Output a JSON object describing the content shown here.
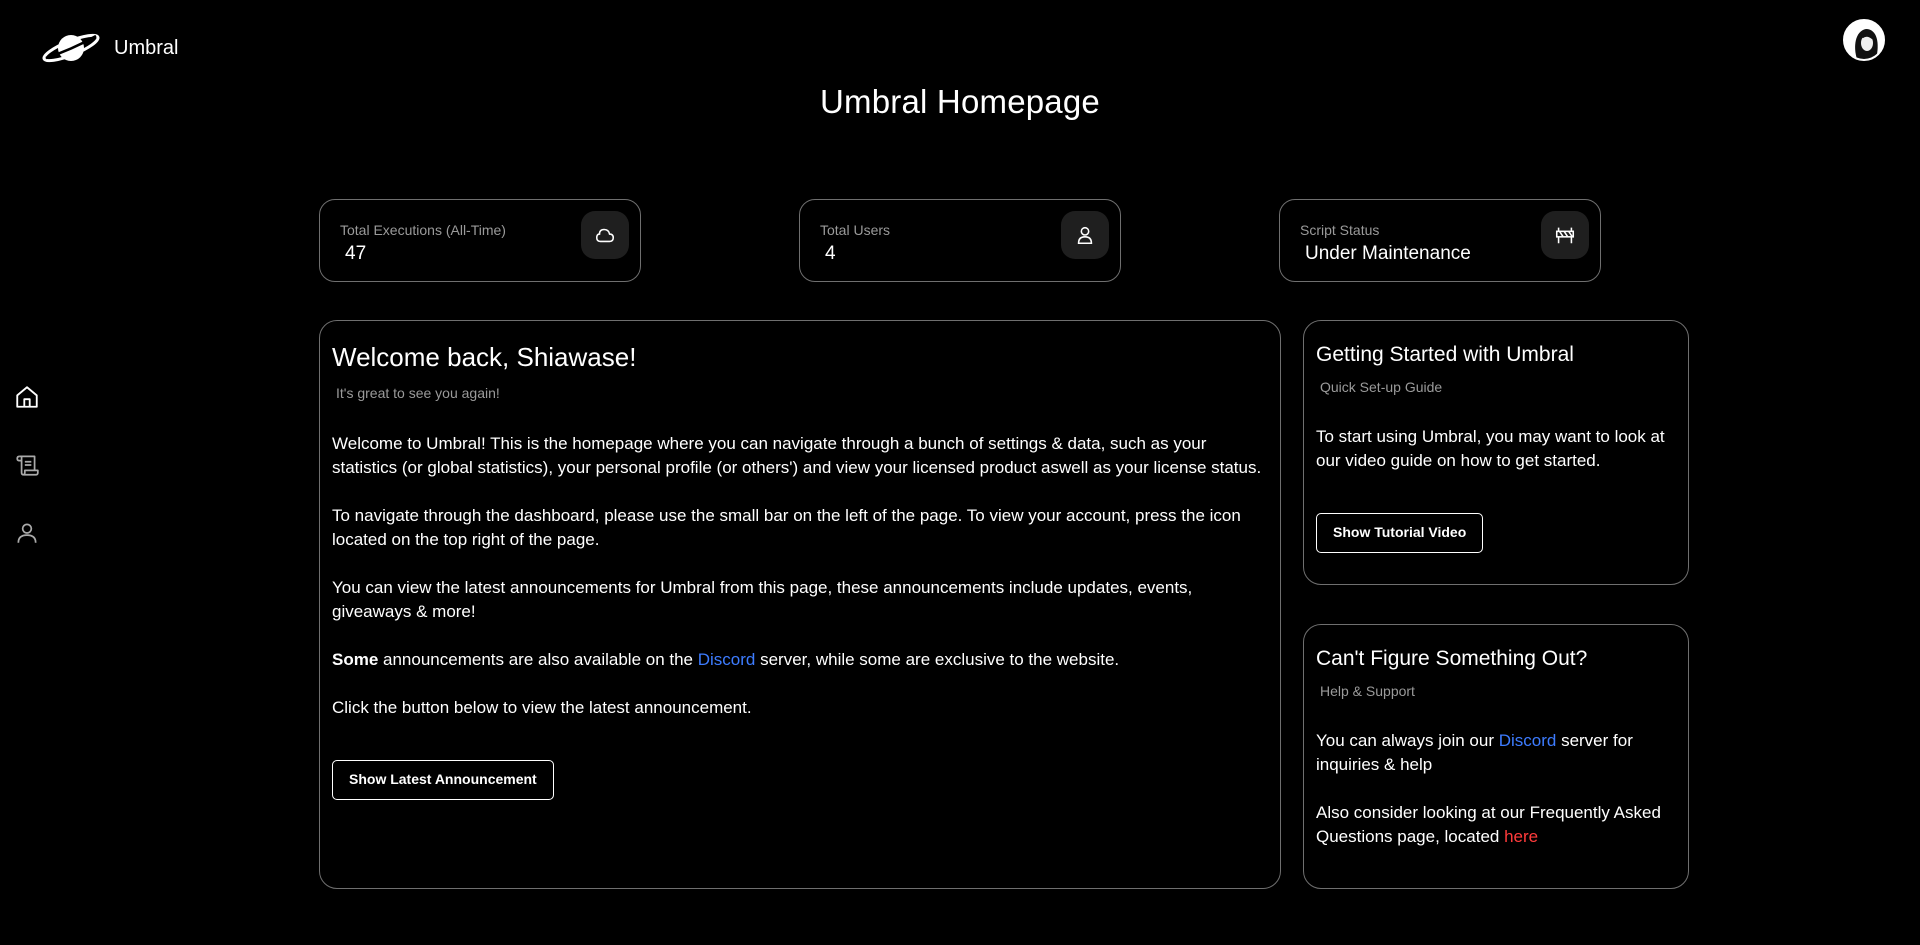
{
  "app": {
    "name": "Umbral",
    "logo_icon": "planet-logo-icon"
  },
  "header": {
    "title": "Umbral Homepage",
    "avatar_icon": "user-avatar"
  },
  "sidebar": {
    "items": [
      {
        "name": "home",
        "icon": "home-icon"
      },
      {
        "name": "scripts",
        "icon": "scroll-icon"
      },
      {
        "name": "profile",
        "icon": "user-icon"
      }
    ]
  },
  "stats": [
    {
      "label": "Total Executions (All-Time)",
      "value": "47",
      "icon": "cloud-icon"
    },
    {
      "label": "Total Users",
      "value": "4",
      "icon": "user-icon"
    },
    {
      "label": "Script Status",
      "value": "Under Maintenance",
      "icon": "barrier-icon"
    }
  ],
  "welcome": {
    "title": "Welcome back, Shiawase!",
    "subtitle": "It's great to see you again!",
    "p1": "Welcome to Umbral! This is the homepage where you can navigate through a bunch of settings & data, such as your statistics (or global statistics), your personal profile (or others') and view your licensed product aswell as your license status.",
    "p2": "To navigate through the dashboard, please use the small bar on the left of the page. To view your account, press the icon located on the top right of the page.",
    "p3": "You can view the latest announcements for Umbral from this page, these announcements include updates, events, giveaways & more!",
    "p4_bold": "Some",
    "p4_pre": " announcements are also available on the ",
    "p4_link": "Discord",
    "p4_post": " server, while some are exclusive to the website.",
    "p5": "Click the button below to view the latest announcement.",
    "button": "Show Latest Announcement"
  },
  "getting_started": {
    "title": "Getting Started with Umbral",
    "subtitle": "Quick Set-up Guide",
    "body": "To start using Umbral, you may want to look at our video guide on how to get started.",
    "button": "Show Tutorial Video"
  },
  "help": {
    "title": "Can't Figure Something Out?",
    "subtitle": "Help & Support",
    "p1_pre": "You can always join our ",
    "p1_link": "Discord",
    "p1_post": " server for inquiries & help",
    "p2_pre": "Also consider looking at our Frequently Asked Questions page, located ",
    "p2_link": "here"
  },
  "colors": {
    "background": "#000000",
    "border": "#6f6f6f",
    "link_blue": "#3d7cff",
    "link_red": "#ff3b3b",
    "muted": "#9a9a9a"
  }
}
